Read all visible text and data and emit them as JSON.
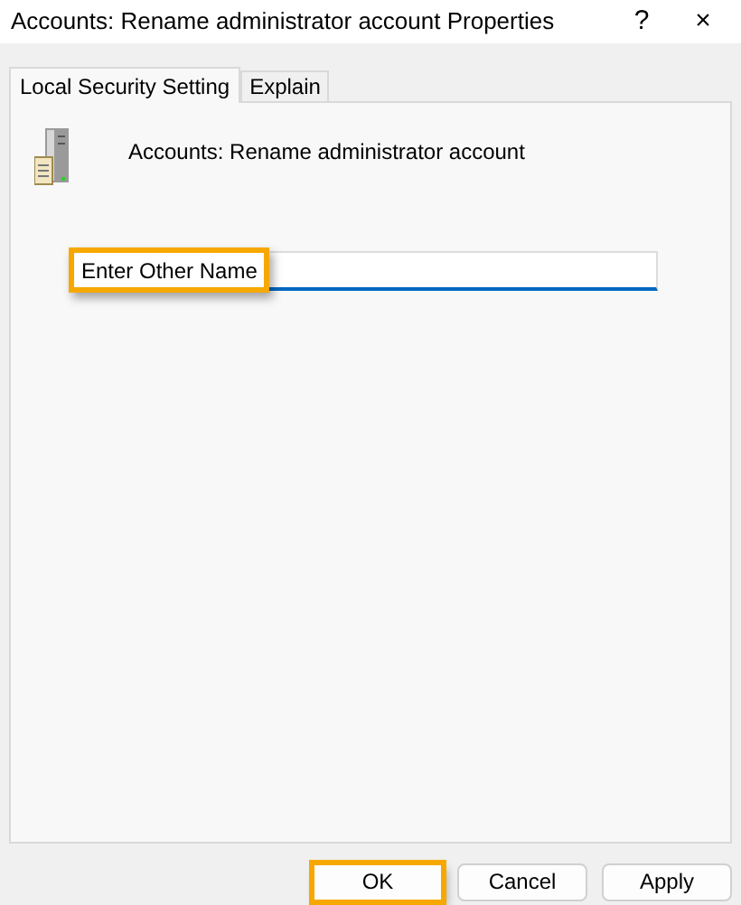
{
  "window": {
    "title": "Accounts: Rename administrator account Properties",
    "controls": [
      "?",
      "×"
    ]
  },
  "tabs": [
    {
      "label": "Local Security Setting",
      "selected": true
    },
    {
      "label": "Explain",
      "selected": false
    }
  ],
  "policy": {
    "name": "Accounts: Rename administrator account"
  },
  "field": {
    "value": "Enter Other Name",
    "highlighted": true
  },
  "buttons": [
    {
      "label": "OK",
      "highlighted": true
    },
    {
      "label": "Cancel",
      "highlighted": false
    },
    {
      "label": "Apply",
      "highlighted": false
    }
  ]
}
